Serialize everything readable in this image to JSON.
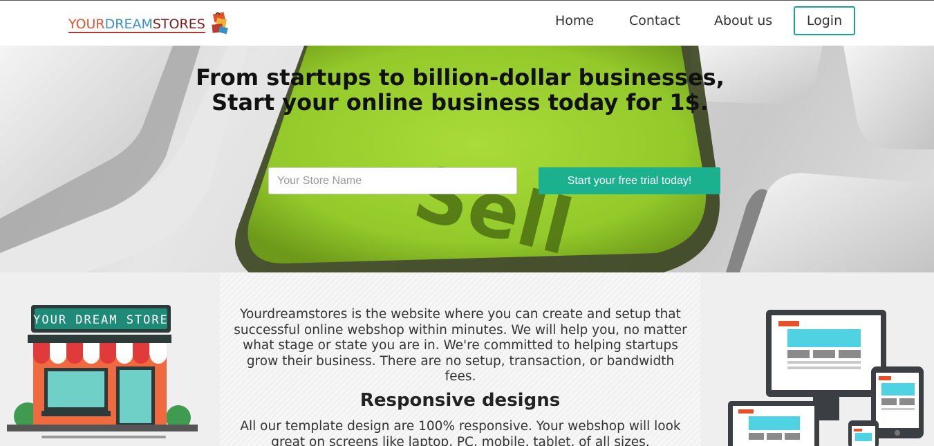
{
  "header": {
    "logo": {
      "part1": "YOUR",
      "part2": "DREAM",
      "part3": "STORES"
    },
    "nav": [
      {
        "label": "Home"
      },
      {
        "label": "Contact"
      },
      {
        "label": "About us"
      }
    ],
    "login_label": "Login"
  },
  "hero": {
    "title_line1": "From startups to billion-dollar businesses,",
    "title_line2": "Start your online business today for 1$.",
    "key_text": "Sell",
    "store_input": {
      "value": "",
      "placeholder": "Your Store Name"
    },
    "cta_label": "Start your free trial today!"
  },
  "content": {
    "store_sign": "YOUR DREAM STORE",
    "intro": "Yourdreamstores is the website where you can create and setup that successful online webshop within minutes. We will help you, no matter what stage or state you are in. We're committed to helping startups grow their business. There are no setup, transaction, or bandwidth fees.",
    "heading": "Responsive designs",
    "text": "All our template design are 100% responsive. Your webshop will look great on screens like laptop, PC, mobile, tablet, of all sizes."
  },
  "colors": {
    "accent": "#1bb08e",
    "login_border": "#1aa28a",
    "key_green": "#9bd12b",
    "logo_orange": "#e2512e",
    "logo_blue": "#3a8fc7",
    "logo_maroon": "#7a1a1a"
  }
}
